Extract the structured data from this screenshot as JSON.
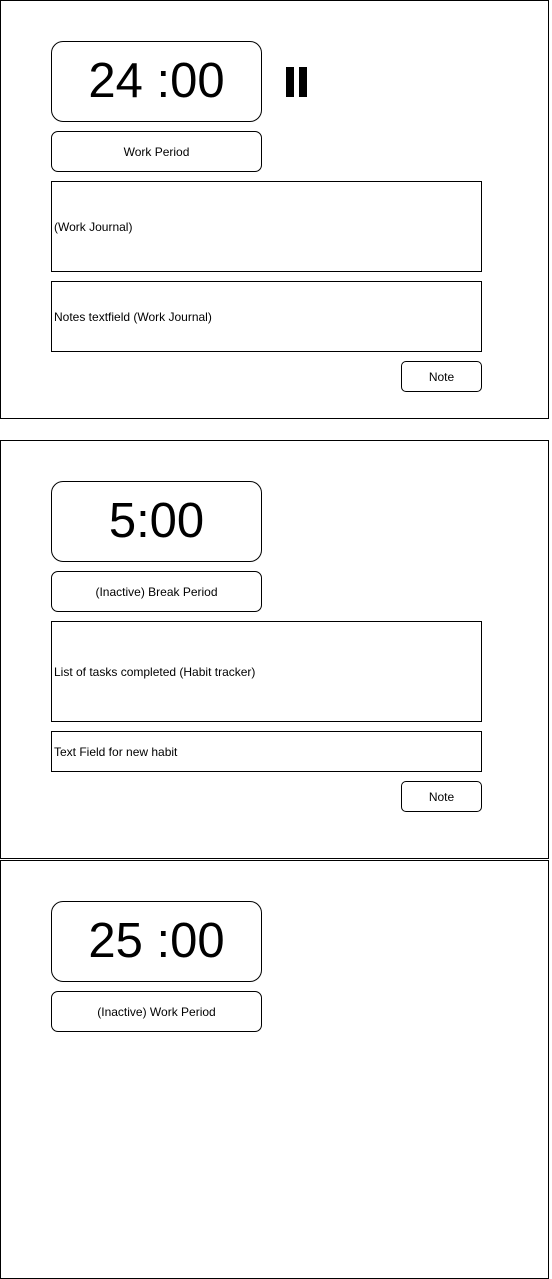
{
  "frames": [
    {
      "timer": "24 :00",
      "period_label": "Work Period",
      "journal_box": "(Work Journal)",
      "notes_field": "Notes textfield (Work Journal)",
      "note_button": "Note",
      "pause_icon": "pause-icon"
    },
    {
      "timer": "5:00",
      "period_label": "(Inactive) Break Period",
      "tasks_box": "List of tasks completed (Habit tracker)",
      "habit_field": "Text Field for new habit",
      "note_button": "Note"
    },
    {
      "timer": "25 :00",
      "period_label": "(Inactive) Work Period"
    }
  ]
}
